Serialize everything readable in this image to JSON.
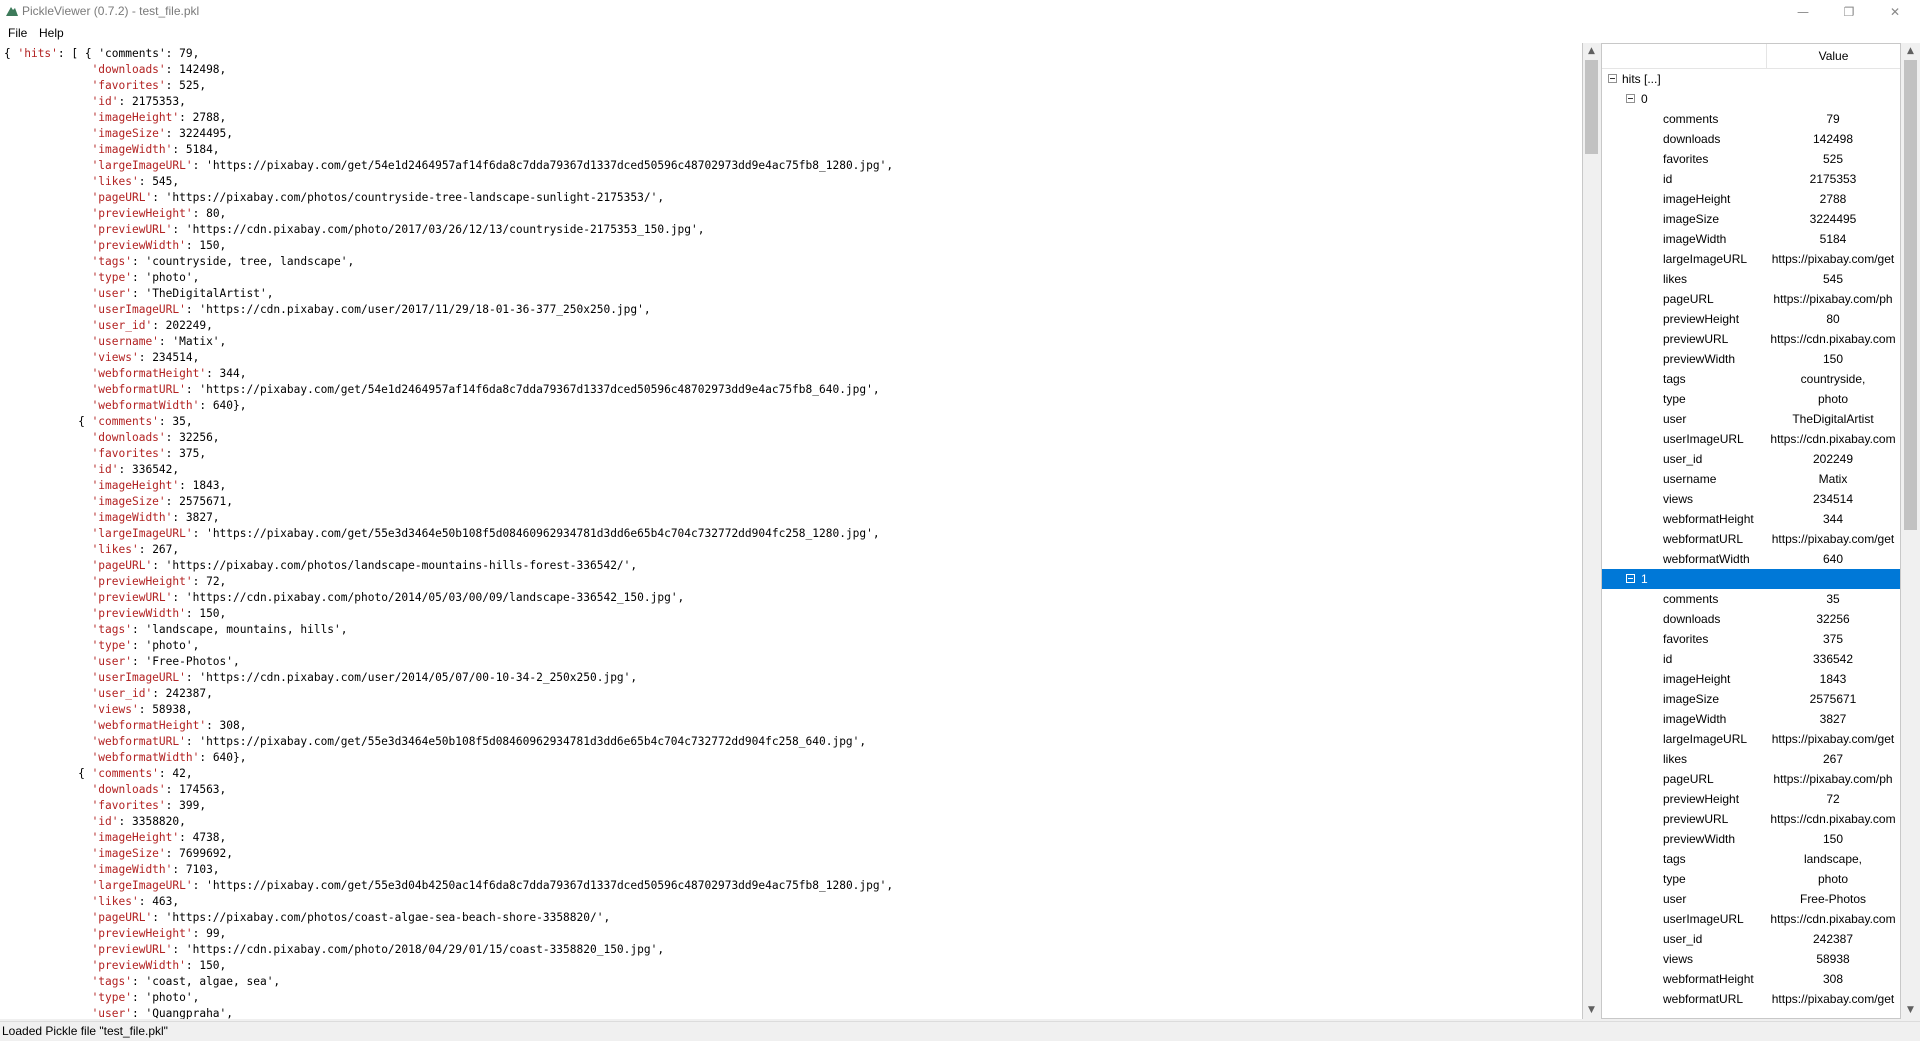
{
  "window": {
    "title": "PickleViewer (0.7.2) - test_file.pkl",
    "icon": "pickle-app-icon",
    "controls": {
      "minimize": "—",
      "maximize": "❐",
      "close": "✕"
    }
  },
  "menu": {
    "file": "File",
    "help": "Help"
  },
  "code_lines": [
    {
      "pre": "{ ",
      "str": "'hits'",
      "post": ": [ { 'comments': 79,"
    },
    {
      "pre": "             ",
      "str": "'downloads'",
      "post": ": 142498,"
    },
    {
      "pre": "             ",
      "str": "'favorites'",
      "post": ": 525,"
    },
    {
      "pre": "             ",
      "str": "'id'",
      "post": ": 2175353,"
    },
    {
      "pre": "             ",
      "str": "'imageHeight'",
      "post": ": 2788,"
    },
    {
      "pre": "             ",
      "str": "'imageSize'",
      "post": ": 3224495,"
    },
    {
      "pre": "             ",
      "str": "'imageWidth'",
      "post": ": 5184,"
    },
    {
      "pre": "             ",
      "str": "'largeImageURL'",
      "post": ": 'https://pixabay.com/get/54e1d2464957af14f6da8c7dda79367d1337dced50596c48702973dd9e4ac75fb8_1280.jpg',"
    },
    {
      "pre": "             ",
      "str": "'likes'",
      "post": ": 545,"
    },
    {
      "pre": "             ",
      "str": "'pageURL'",
      "post": ": 'https://pixabay.com/photos/countryside-tree-landscape-sunlight-2175353/',"
    },
    {
      "pre": "             ",
      "str": "'previewHeight'",
      "post": ": 80,"
    },
    {
      "pre": "             ",
      "str": "'previewURL'",
      "post": ": 'https://cdn.pixabay.com/photo/2017/03/26/12/13/countryside-2175353_150.jpg',"
    },
    {
      "pre": "             ",
      "str": "'previewWidth'",
      "post": ": 150,"
    },
    {
      "pre": "             ",
      "str": "'tags'",
      "post": ": 'countryside, tree, landscape',"
    },
    {
      "pre": "             ",
      "str": "'type'",
      "post": ": 'photo',"
    },
    {
      "pre": "             ",
      "str": "'user'",
      "post": ": 'TheDigitalArtist',"
    },
    {
      "pre": "             ",
      "str": "'userImageURL'",
      "post": ": 'https://cdn.pixabay.com/user/2017/11/29/18-01-36-377_250x250.jpg',"
    },
    {
      "pre": "             ",
      "str": "'user_id'",
      "post": ": 202249,"
    },
    {
      "pre": "             ",
      "str": "'username'",
      "post": ": 'Matix',"
    },
    {
      "pre": "             ",
      "str": "'views'",
      "post": ": 234514,"
    },
    {
      "pre": "             ",
      "str": "'webformatHeight'",
      "post": ": 344,"
    },
    {
      "pre": "             ",
      "str": "'webformatURL'",
      "post": ": 'https://pixabay.com/get/54e1d2464957af14f6da8c7dda79367d1337dced50596c48702973dd9e4ac75fb8_640.jpg',"
    },
    {
      "pre": "             ",
      "str": "'webformatWidth'",
      "post": ": 640},"
    },
    {
      "pre": "           { ",
      "str": "'comments'",
      "post": ": 35,"
    },
    {
      "pre": "             ",
      "str": "'downloads'",
      "post": ": 32256,"
    },
    {
      "pre": "             ",
      "str": "'favorites'",
      "post": ": 375,"
    },
    {
      "pre": "             ",
      "str": "'id'",
      "post": ": 336542,"
    },
    {
      "pre": "             ",
      "str": "'imageHeight'",
      "post": ": 1843,"
    },
    {
      "pre": "             ",
      "str": "'imageSize'",
      "post": ": 2575671,"
    },
    {
      "pre": "             ",
      "str": "'imageWidth'",
      "post": ": 3827,"
    },
    {
      "pre": "             ",
      "str": "'largeImageURL'",
      "post": ": 'https://pixabay.com/get/55e3d3464e50b108f5d08460962934781d3dd6e65b4c704c732772dd904fc258_1280.jpg',"
    },
    {
      "pre": "             ",
      "str": "'likes'",
      "post": ": 267,"
    },
    {
      "pre": "             ",
      "str": "'pageURL'",
      "post": ": 'https://pixabay.com/photos/landscape-mountains-hills-forest-336542/',"
    },
    {
      "pre": "             ",
      "str": "'previewHeight'",
      "post": ": 72,"
    },
    {
      "pre": "             ",
      "str": "'previewURL'",
      "post": ": 'https://cdn.pixabay.com/photo/2014/05/03/00/09/landscape-336542_150.jpg',"
    },
    {
      "pre": "             ",
      "str": "'previewWidth'",
      "post": ": 150,"
    },
    {
      "pre": "             ",
      "str": "'tags'",
      "post": ": 'landscape, mountains, hills',"
    },
    {
      "pre": "             ",
      "str": "'type'",
      "post": ": 'photo',"
    },
    {
      "pre": "             ",
      "str": "'user'",
      "post": ": 'Free-Photos',"
    },
    {
      "pre": "             ",
      "str": "'userImageURL'",
      "post": ": 'https://cdn.pixabay.com/user/2014/05/07/00-10-34-2_250x250.jpg',"
    },
    {
      "pre": "             ",
      "str": "'user_id'",
      "post": ": 242387,"
    },
    {
      "pre": "             ",
      "str": "'views'",
      "post": ": 58938,"
    },
    {
      "pre": "             ",
      "str": "'webformatHeight'",
      "post": ": 308,"
    },
    {
      "pre": "             ",
      "str": "'webformatURL'",
      "post": ": 'https://pixabay.com/get/55e3d3464e50b108f5d08460962934781d3dd6e65b4c704c732772dd904fc258_640.jpg',"
    },
    {
      "pre": "             ",
      "str": "'webformatWidth'",
      "post": ": 640},"
    },
    {
      "pre": "           { ",
      "str": "'comments'",
      "post": ": 42,"
    },
    {
      "pre": "             ",
      "str": "'downloads'",
      "post": ": 174563,"
    },
    {
      "pre": "             ",
      "str": "'favorites'",
      "post": ": 399,"
    },
    {
      "pre": "             ",
      "str": "'id'",
      "post": ": 3358820,"
    },
    {
      "pre": "             ",
      "str": "'imageHeight'",
      "post": ": 4738,"
    },
    {
      "pre": "             ",
      "str": "'imageSize'",
      "post": ": 7699692,"
    },
    {
      "pre": "             ",
      "str": "'imageWidth'",
      "post": ": 7103,"
    },
    {
      "pre": "             ",
      "str": "'largeImageURL'",
      "post": ": 'https://pixabay.com/get/55e3d04b4250ac14f6da8c7dda79367d1337dced50596c48702973dd9e4ac75fb8_1280.jpg',"
    },
    {
      "pre": "             ",
      "str": "'likes'",
      "post": ": 463,"
    },
    {
      "pre": "             ",
      "str": "'pageURL'",
      "post": ": 'https://pixabay.com/photos/coast-algae-sea-beach-shore-3358820/',"
    },
    {
      "pre": "             ",
      "str": "'previewHeight'",
      "post": ": 99,"
    },
    {
      "pre": "             ",
      "str": "'previewURL'",
      "post": ": 'https://cdn.pixabay.com/photo/2018/04/29/01/15/coast-3358820_150.jpg',"
    },
    {
      "pre": "             ",
      "str": "'previewWidth'",
      "post": ": 150,"
    },
    {
      "pre": "             ",
      "str": "'tags'",
      "post": ": 'coast, algae, sea',"
    },
    {
      "pre": "             ",
      "str": "'type'",
      "post": ": 'photo',"
    },
    {
      "pre": "             ",
      "str": "'user'",
      "post": ": 'Quangpraha',"
    }
  ],
  "tree": {
    "header_value": "Value",
    "root_label": "hits [...]",
    "node0_label": "0",
    "node1_label": "1",
    "node0": [
      {
        "key": "comments",
        "val": "79"
      },
      {
        "key": "downloads",
        "val": "142498"
      },
      {
        "key": "favorites",
        "val": "525"
      },
      {
        "key": "id",
        "val": "2175353"
      },
      {
        "key": "imageHeight",
        "val": "2788"
      },
      {
        "key": "imageSize",
        "val": "3224495"
      },
      {
        "key": "imageWidth",
        "val": "5184"
      },
      {
        "key": "largeImageURL",
        "val": "https://pixabay.com/get"
      },
      {
        "key": "likes",
        "val": "545"
      },
      {
        "key": "pageURL",
        "val": "https://pixabay.com/ph"
      },
      {
        "key": "previewHeight",
        "val": "80"
      },
      {
        "key": "previewURL",
        "val": "https://cdn.pixabay.com"
      },
      {
        "key": "previewWidth",
        "val": "150"
      },
      {
        "key": "tags",
        "val": "countryside,"
      },
      {
        "key": "type",
        "val": "photo"
      },
      {
        "key": "user",
        "val": "TheDigitalArtist"
      },
      {
        "key": "userImageURL",
        "val": "https://cdn.pixabay.com"
      },
      {
        "key": "user_id",
        "val": "202249"
      },
      {
        "key": "username",
        "val": "Matix"
      },
      {
        "key": "views",
        "val": "234514"
      },
      {
        "key": "webformatHeight",
        "val": "344"
      },
      {
        "key": "webformatURL",
        "val": "https://pixabay.com/get"
      },
      {
        "key": "webformatWidth",
        "val": "640"
      }
    ],
    "node1": [
      {
        "key": "comments",
        "val": "35"
      },
      {
        "key": "downloads",
        "val": "32256"
      },
      {
        "key": "favorites",
        "val": "375"
      },
      {
        "key": "id",
        "val": "336542"
      },
      {
        "key": "imageHeight",
        "val": "1843"
      },
      {
        "key": "imageSize",
        "val": "2575671"
      },
      {
        "key": "imageWidth",
        "val": "3827"
      },
      {
        "key": "largeImageURL",
        "val": "https://pixabay.com/get"
      },
      {
        "key": "likes",
        "val": "267"
      },
      {
        "key": "pageURL",
        "val": "https://pixabay.com/ph"
      },
      {
        "key": "previewHeight",
        "val": "72"
      },
      {
        "key": "previewURL",
        "val": "https://cdn.pixabay.com"
      },
      {
        "key": "previewWidth",
        "val": "150"
      },
      {
        "key": "tags",
        "val": "landscape,"
      },
      {
        "key": "type",
        "val": "photo"
      },
      {
        "key": "user",
        "val": "Free-Photos"
      },
      {
        "key": "userImageURL",
        "val": "https://cdn.pixabay.com"
      },
      {
        "key": "user_id",
        "val": "242387"
      },
      {
        "key": "views",
        "val": "58938"
      },
      {
        "key": "webformatHeight",
        "val": "308"
      },
      {
        "key": "webformatURL",
        "val": "https://pixabay.com/get"
      }
    ]
  },
  "status": {
    "text": "Loaded Pickle file \"test_file.pkl\""
  },
  "colors": {
    "selection": "#0078d7",
    "string": "#b22222"
  }
}
